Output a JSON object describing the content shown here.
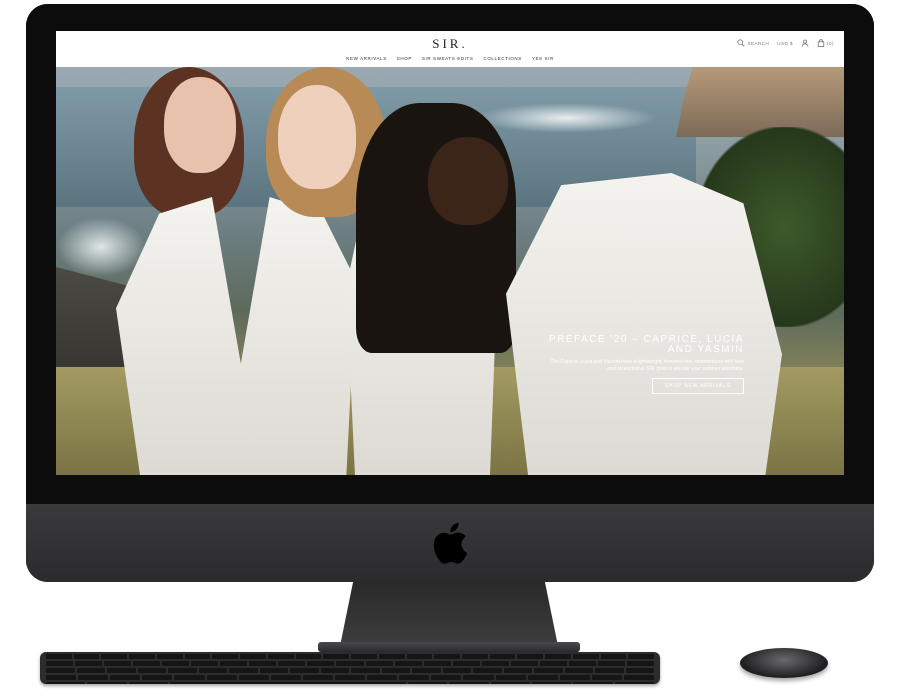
{
  "site": {
    "logo": "SIR."
  },
  "nav": {
    "items": [
      "NEW ARRIVALS",
      "SHOP",
      "SIR SWEATS EDITS",
      "COLLECTIONS",
      "YES SIR"
    ]
  },
  "header_tools": {
    "search_label": "SEARCH",
    "currency": "USD $",
    "cart_count": "(0)"
  },
  "hero": {
    "title": "PREFACE '20 – CAPRICE, LUCIA AND YASMIN",
    "description": "The Caprice, Lucia and Yasmin have a lightweight, feminine feel, embroidered with lace and an exclusive SIR. print to elevate your summer wardrobe.",
    "cta_label": "SHOP NEW ARRIVALS"
  },
  "icons": {
    "search": "search-icon",
    "account": "user-icon",
    "cart": "bag-icon",
    "chat": "chat-icon",
    "apple": "apple-logo-icon"
  },
  "colors": {
    "header_bg": "#ffffff",
    "device_body": "#2b2b2d",
    "text_dark": "#222222",
    "promo_text": "#ffffff"
  }
}
